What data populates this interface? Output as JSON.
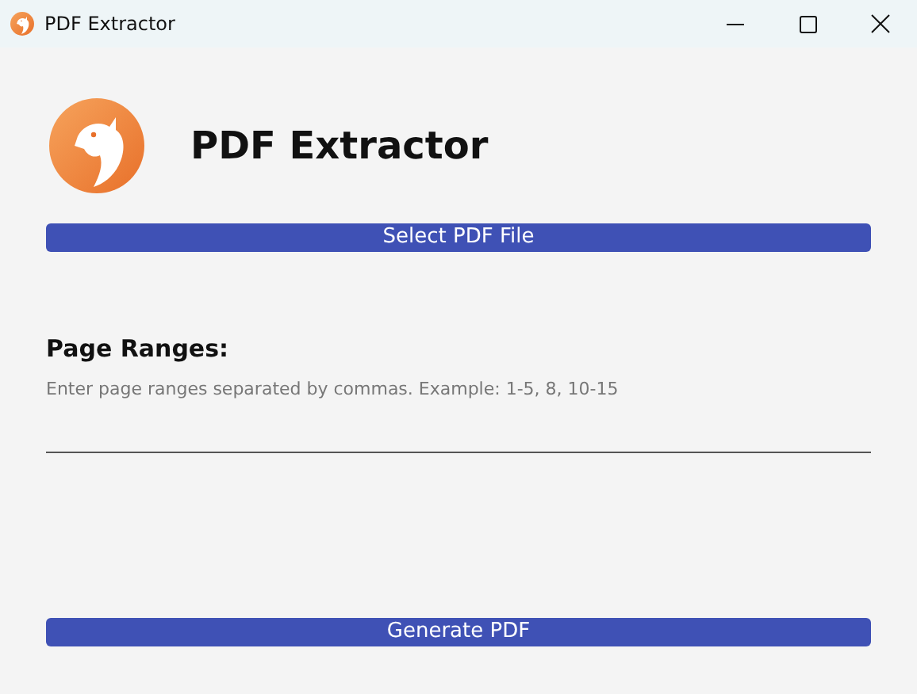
{
  "window": {
    "title": "PDF Extractor"
  },
  "header": {
    "title": "PDF Extractor"
  },
  "select_button": {
    "label": "Select PDF File"
  },
  "page_ranges": {
    "label": "Page Ranges:",
    "placeholder": "Enter page ranges separated by commas. Example: 1-5, 8, 10-15"
  },
  "generate_button": {
    "label": "Generate PDF"
  }
}
